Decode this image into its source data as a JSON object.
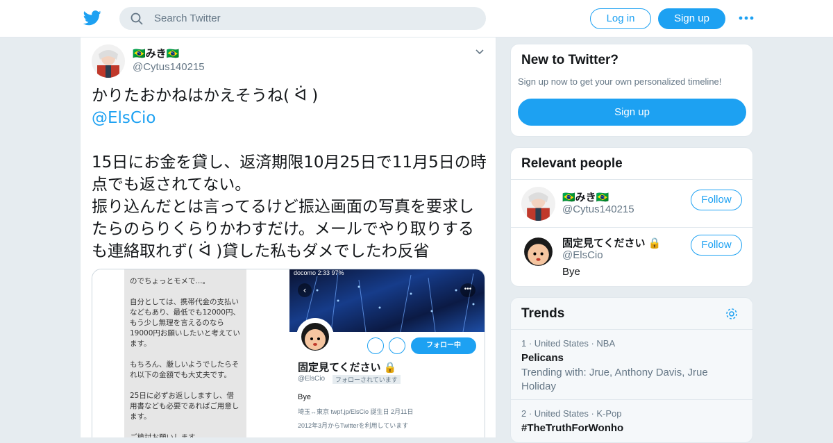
{
  "header": {
    "search_placeholder": "Search Twitter",
    "login_label": "Log in",
    "signup_label": "Sign up"
  },
  "tweet": {
    "display_name": "🇧🇷みき🇧🇷",
    "handle": "@Cytus140215",
    "text_line1": "かりたおかねはかえそうね( ᐛ )",
    "mention": "@ElsCio",
    "text_body": "15日にお金を貸し、返済期限10月25日で11月5日の時点でも返されてない。\n振り込んだとは言ってるけど振込画面の写真を要求したらのらりくらりかわすだけ。メールでやり取りするも連絡取れず( ᐛ )貸した私もダメでしたわ反省",
    "media_left_text": "のでちょっとモメで...。\n\n自分としては、携帯代金の支払いなどもあり、最低でも12000円、もう少し無理を言えるのなら19000円お願いしたいと考えています。\n\nもちろん、厳しいようでしたらそれ以下の金額でも大丈夫です。\n\n25日に必ずお返ししますし、借用書なども必要であればご用意します。\n\nご検討お願いします。\n本当にすみません...😖🙇",
    "media_right": {
      "status": "docomo  2:33  97%",
      "follow_label": "フォロー中",
      "name": "固定見てください 🔒",
      "handle": "@ElsCio",
      "follows_you": "フォローされています",
      "bio": "Bye",
      "meta1": "埼玉↔東京   twpf.jp/ElsCio   誕生日 2月11日",
      "meta2": "2012年3月からTwitterを利用しています"
    }
  },
  "new_to_twitter": {
    "title": "New to Twitter?",
    "subtitle": "Sign up now to get your own personalized timeline!",
    "button": "Sign up"
  },
  "relevant_people": {
    "title": "Relevant people",
    "people": [
      {
        "name": "🇧🇷みき🇧🇷",
        "handle": "@Cytus140215",
        "bio": "",
        "button": "Follow"
      },
      {
        "name": "固定見てください 🔒",
        "handle": "@ElsCio",
        "bio": "Bye",
        "button": "Follow"
      }
    ]
  },
  "trends": {
    "title": "Trends",
    "items": [
      {
        "meta": "1 · United States · NBA",
        "name": "Pelicans",
        "desc": "Trending with: Jrue, Anthony Davis, Jrue Holiday"
      },
      {
        "meta": "2 · United States · K-Pop",
        "name": "#TheTruthForWonho",
        "desc": ""
      }
    ]
  },
  "colors": {
    "accent": "#1da1f2",
    "background": "#e6ecf0",
    "muted": "#657786"
  }
}
